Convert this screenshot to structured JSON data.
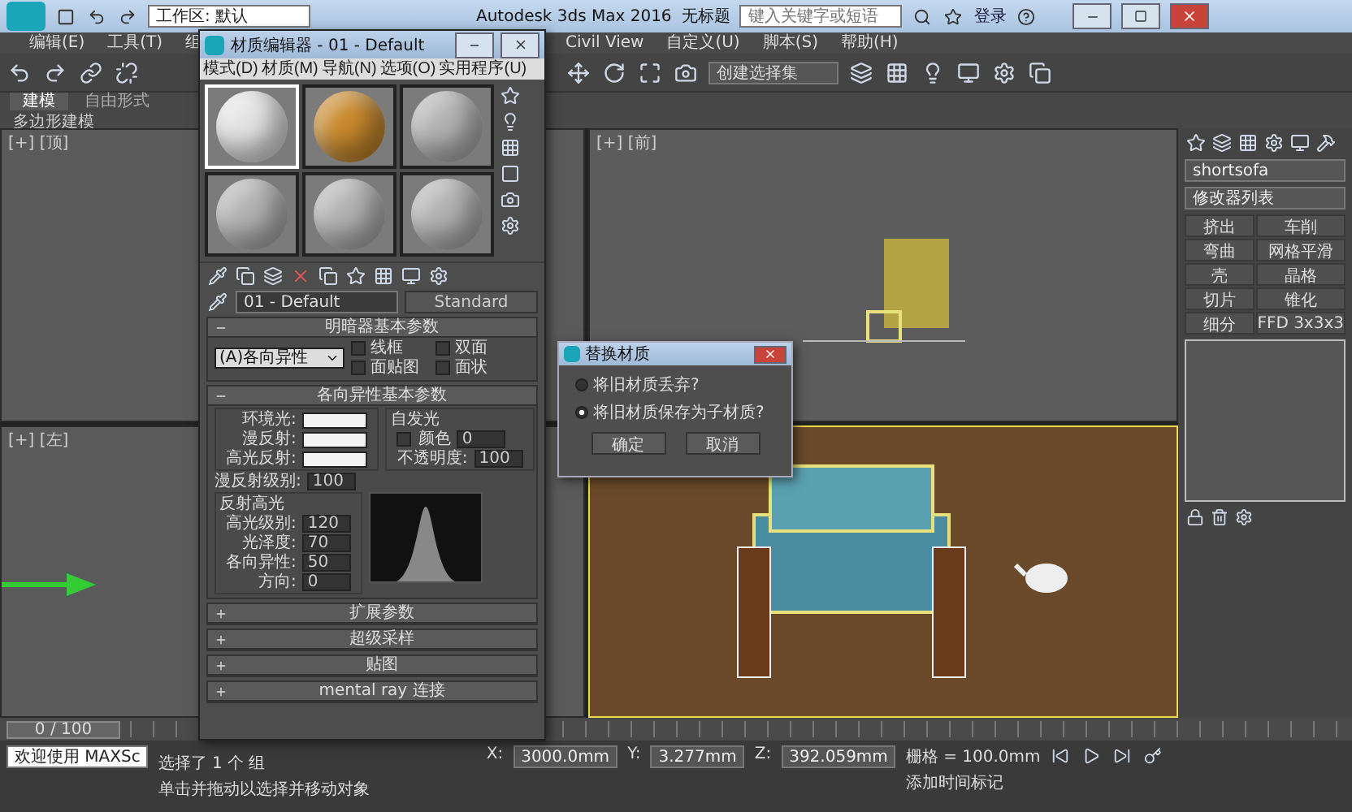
{
  "title_bar": {
    "workspace": "工作区: 默认",
    "app_title": "Autodesk 3ds Max 2016",
    "document": "无标题",
    "search": {
      "placeholder": "键入关键字或短语"
    },
    "sign_in": "登录"
  },
  "menu_bar": [
    "编辑(E)",
    "工具(T)",
    "组",
    "Civil View",
    "自定义(U)",
    "脚本(S)",
    "帮助(H)"
  ],
  "toolbar": {
    "selection_set": "创建选择集"
  },
  "ribbon": {
    "tabs": [
      {
        "label": "建模",
        "selected": true
      },
      {
        "label": "自由形式",
        "selected": false
      }
    ],
    "panel_label": "多边形建模"
  },
  "viewports": [
    {
      "label": "[+] [顶]",
      "kind": "top"
    },
    {
      "label": "[+] [前]",
      "kind": "front"
    },
    {
      "label": "[+] [左]",
      "kind": "left"
    },
    {
      "kind": "perspective"
    }
  ],
  "material_editor": {
    "title": "材质编辑器 - 01 - Default",
    "menus": [
      "模式(D)",
      "材质(M)",
      "导航(N)",
      "选项(O)",
      "实用程序(U)"
    ],
    "samples": [
      {
        "color": "#e4e4e4",
        "selected": true
      },
      {
        "color": "#c98a2e",
        "selected": false
      },
      {
        "color": "#b4b4b4",
        "selected": false
      },
      {
        "color": "#b4b4b4",
        "selected": false
      },
      {
        "color": "#b4b4b4",
        "selected": false
      },
      {
        "color": "#b4b4b4",
        "selected": false
      }
    ],
    "material_name": "01 - Default",
    "material_type": "Standard",
    "shader_rollout": {
      "title": "明暗器基本参数",
      "shader": "(A)各向异性",
      "options": [
        {
          "label": "线框",
          "checked": false
        },
        {
          "label": "双面",
          "checked": false
        },
        {
          "label": "面贴图",
          "checked": false
        },
        {
          "label": "面状",
          "checked": false
        }
      ]
    },
    "basic_rollout": {
      "title": "各向异性基本参数",
      "colors": [
        "环境光:",
        "漫反射:",
        "高光反射:"
      ],
      "self_illum": {
        "title": "自发光",
        "label": "颜色",
        "value": "0",
        "checked": false
      },
      "opacity": {
        "label": "不透明度:",
        "value": "100"
      },
      "diffuse_level": {
        "label": "漫反射级别:",
        "value": "100"
      },
      "highlights": {
        "title": "反射高光",
        "fields": [
          {
            "label": "高光级别:",
            "value": "120"
          },
          {
            "label": "光泽度:",
            "value": "70"
          },
          {
            "label": "各向异性:",
            "value": "50"
          },
          {
            "label": "方向:",
            "value": "0"
          }
        ]
      }
    },
    "rollouts": [
      "扩展参数",
      "超级采样",
      "贴图",
      "mental ray 连接"
    ]
  },
  "dialog": {
    "title": "替换材质",
    "options": [
      {
        "label": "将旧材质丢弃?",
        "selected": false
      },
      {
        "label": "将旧材质保存为子材质?",
        "selected": true
      }
    ],
    "buttons": [
      "确定",
      "取消"
    ]
  },
  "command_panel": {
    "object_name": "shortsofa",
    "modifier_list": "修改器列表",
    "modifiers": [
      "挤出",
      "车削",
      "弯曲",
      "网格平滑",
      "壳",
      "晶格",
      "切片",
      "锥化",
      "细分",
      "FFD 3x3x3"
    ]
  },
  "timeline": {
    "frame": "0 / 100"
  },
  "status_bar": {
    "listener": "欢迎使用 MAXSc",
    "selection": "选择了 1 个 组",
    "prompt": "单击并拖动以选择并移动对象",
    "coordinates": [
      {
        "label": "X:",
        "value": "3000.0mm"
      },
      {
        "label": "Y:",
        "value": "3.277mm"
      },
      {
        "label": "Z:",
        "value": "392.059mm"
      }
    ],
    "grid": "栅格 = 100.0mm",
    "time_tag": "添加时间标记"
  }
}
